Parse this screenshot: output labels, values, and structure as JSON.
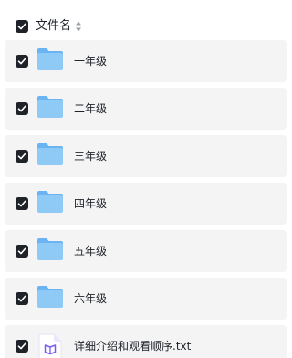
{
  "header": {
    "label": "文件名",
    "checked": true
  },
  "files": [
    {
      "name": "一年级",
      "type": "folder",
      "checked": true
    },
    {
      "name": "二年级",
      "type": "folder",
      "checked": true
    },
    {
      "name": "三年级",
      "type": "folder",
      "checked": true
    },
    {
      "name": "四年级",
      "type": "folder",
      "checked": true
    },
    {
      "name": "五年级",
      "type": "folder",
      "checked": true
    },
    {
      "name": "六年级",
      "type": "folder",
      "checked": true
    },
    {
      "name": "详细介绍和观看顺序.txt",
      "type": "txt",
      "checked": true
    }
  ],
  "colors": {
    "checkbox_fill": "#1f2329",
    "row_background": "#f4f4f5",
    "folder_blue": "#7cc0f5",
    "folder_blue_light": "#a9d6fa",
    "txt_accent": "#7b5cf0"
  },
  "icons": {
    "sort": "sort-icon",
    "folder": "folder-icon",
    "txt": "txt-file-icon",
    "check": "check-icon"
  }
}
